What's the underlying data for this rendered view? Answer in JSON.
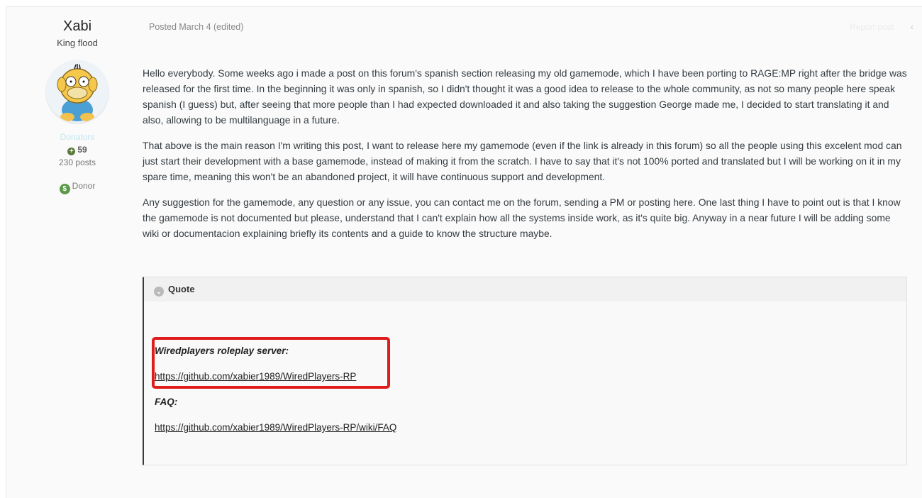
{
  "author": {
    "name": "Xabi",
    "title": "King flood",
    "group": "Donators",
    "reputation": "59",
    "posts": "230 posts",
    "badge": "Donor"
  },
  "post": {
    "meta": "Posted March 4 (edited)",
    "report": "Report post",
    "paragraphs": [
      "Hello everybody. Some weeks ago i made a post on this forum's spanish section releasing my old gamemode, which I have been porting to RAGE:MP right after the bridge was released for the first time. In the beginning it was only in spanish, so I didn't thought it was a good idea to release to the whole community, as not so many people here speak spanish (I guess) but, after seeing that more people than I had expected downloaded it and also taking the suggestion George made me, I decided to start translating it and also, allowing to be multilanguage in a future.",
      "That above is the main reason I'm writing this post, I want to release here my gamemode (even if the link is already in this forum) so all the people using this excelent mod can just start their development with a base gamemode, instead of making it from the scratch. I have to say that it's not 100% ported and translated but I will be working on it in my spare time, meaning this won't be an abandoned project, it will have continuous support and development.",
      "Any suggestion for the gamemode, any question or any issue, you can contact me on the forum, sending a PM or posting here. One last thing I have to point out is that I know the gamemode is not documented but please, understand that I can't explain how all the systems inside work, as it's quite big. Anyway in a near future I will be adding some wiki or documentacion explaining briefly its contents and a guide to know the structure maybe."
    ]
  },
  "quote": {
    "header": "Quote",
    "server_label": "Wiredplayers roleplay server:",
    "server_link": "https://github.com/xabier1989/WiredPlayers-RP",
    "faq_label": "FAQ:",
    "faq_link": "https://github.com/xabier1989/WiredPlayers-RP/wiki/FAQ"
  },
  "colors": {
    "highlight": "#e01b1b",
    "donators": "#bfe6f2"
  },
  "icons": {
    "reputation": "plus-circle-icon",
    "badge": "dollar-circle-icon",
    "quote_toggle": "chevron-down-icon",
    "share": "share-icon"
  }
}
